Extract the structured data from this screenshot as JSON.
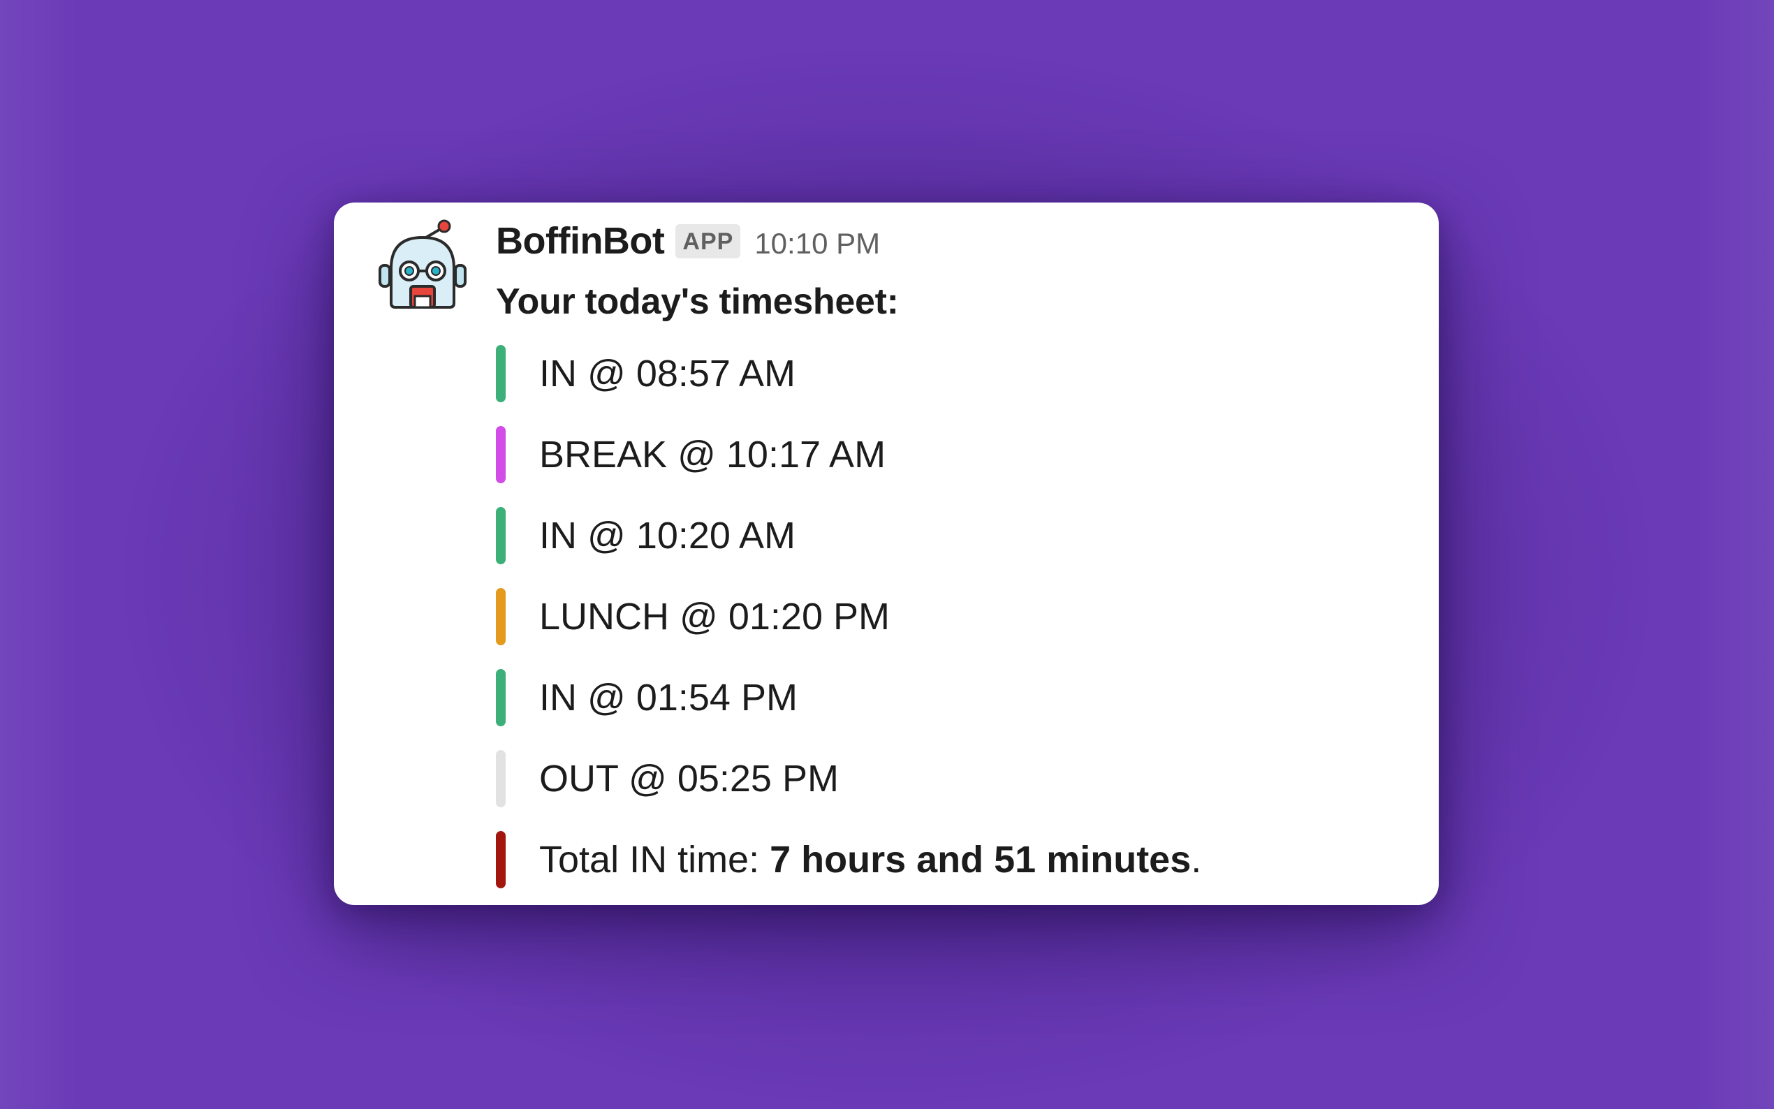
{
  "message": {
    "author": "BoffinBot",
    "badge": "APP",
    "timestamp": "10:10 PM",
    "intro": "Your today's timesheet:",
    "avatar_icon": "robot-icon"
  },
  "entries": [
    {
      "text": "IN @ 08:57 AM",
      "color": "#3DB07A"
    },
    {
      "text": "BREAK @ 10:17 AM",
      "color": "#D24DE8"
    },
    {
      "text": "IN @ 10:20 AM",
      "color": "#3DB07A"
    },
    {
      "text": "LUNCH @ 01:20 PM",
      "color": "#E39A1D"
    },
    {
      "text": "IN @ 01:54 PM",
      "color": "#3DB07A"
    },
    {
      "text": "OUT @ 05:25 PM",
      "color": "#E2E2E2"
    }
  ],
  "total": {
    "prefix": "Total IN time: ",
    "value": "7 hours and 51 minutes",
    "suffix": ".",
    "color": "#A3160E"
  },
  "colors": {
    "background": "#6A3AB7",
    "card": "#FFFFFF"
  }
}
